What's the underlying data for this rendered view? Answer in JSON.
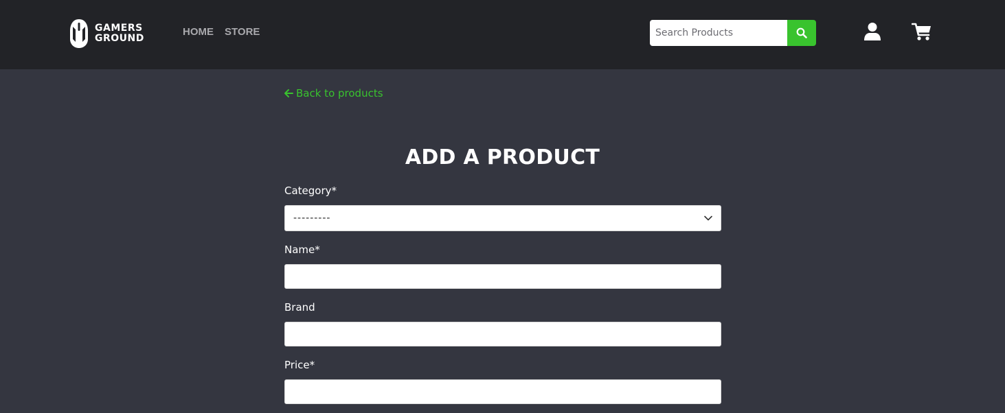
{
  "header": {
    "logo": {
      "line1": "GAMERS",
      "line2": "GROUND",
      "icon": "gamer-mouse-icon"
    },
    "nav": {
      "home": "HOME",
      "store": "STORE"
    },
    "search": {
      "placeholder": "Search Products",
      "value": "",
      "button_icon": "search-icon"
    },
    "account_icon": "user-icon",
    "cart_icon": "shopping-cart-icon"
  },
  "colors": {
    "header_bg": "#222327",
    "page_bg": "#343640",
    "accent": "#39c32e",
    "nav_text": "#a9a9ad"
  },
  "back_link": {
    "label": "Back to products",
    "icon": "arrow-left-icon"
  },
  "form": {
    "title": "ADD A PRODUCT",
    "category": {
      "label": "Category*",
      "selected": "---------",
      "icon": "chevron-down-icon"
    },
    "name": {
      "label": "Name*",
      "value": ""
    },
    "brand": {
      "label": "Brand",
      "value": ""
    },
    "price": {
      "label": "Price*",
      "value": ""
    }
  }
}
